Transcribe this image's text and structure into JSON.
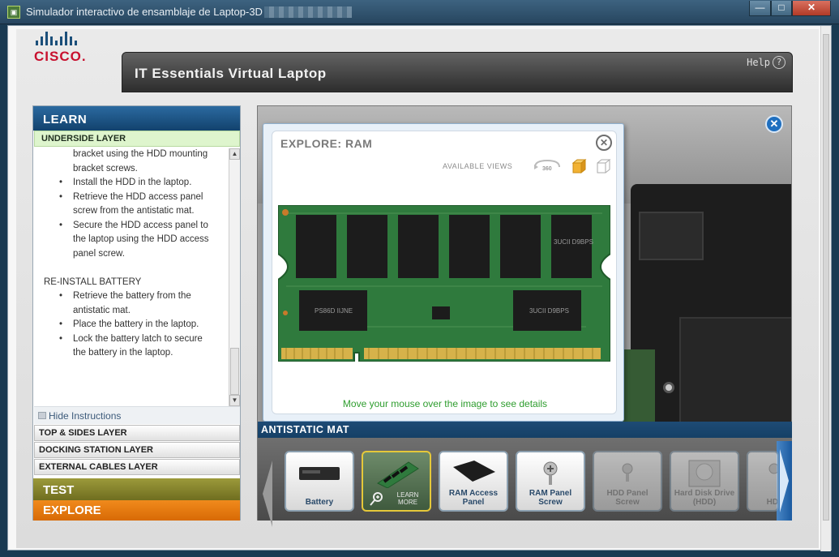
{
  "window": {
    "title": "Simulador interactivo de ensamblaje de Laptop-3D",
    "min": "—",
    "max": "□",
    "close": "✕"
  },
  "logo": {
    "text": "CISCO."
  },
  "header": {
    "title": "IT Essentials Virtual Laptop",
    "help": "Help",
    "help_icon": "?"
  },
  "sidebar": {
    "learn": "LEARN",
    "underside": "UNDERSIDE LAYER",
    "instructions": [
      {
        "type": "cont",
        "text": "bracket using the HDD mounting"
      },
      {
        "type": "cont",
        "text": "bracket screws."
      },
      {
        "type": "bullet",
        "text": "Install the HDD in the  laptop."
      },
      {
        "type": "bullet",
        "text": "Retrieve the HDD  access panel"
      },
      {
        "type": "cont",
        "text": "screw from the antistatic mat."
      },
      {
        "type": "bullet",
        "text": "Secure the HDD access  panel to"
      },
      {
        "type": "cont",
        "text": "the laptop using the HDD access"
      },
      {
        "type": "cont",
        "text": "panel screw."
      },
      {
        "type": "section",
        "text": "RE-INSTALL BATTERY"
      },
      {
        "type": "bullet",
        "text": "Retrieve the battery  from the"
      },
      {
        "type": "cont",
        "text": "antistatic mat."
      },
      {
        "type": "bullet",
        "text": "Place the battery in the  laptop."
      },
      {
        "type": "bullet",
        "text": "Lock the battery latch  to secure"
      },
      {
        "type": "cont",
        "text": "the battery in the laptop."
      }
    ],
    "hide": "Hide Instructions",
    "layers": [
      "TOP & SIDES LAYER",
      "DOCKING STATION LAYER",
      "EXTERNAL CABLES LAYER"
    ],
    "test": "TEST",
    "explore": "EXPLORE"
  },
  "popup": {
    "title": "EXPLORE: RAM",
    "close": "✕",
    "views_label": "AVAILABLE VIEWS",
    "view_360": "360",
    "hint": "Move your mouse over the image to see details",
    "chip_labels": [
      "3UCII D9BPS",
      "PS86D IIJNE",
      "3UCII D9BPS"
    ]
  },
  "main": {
    "close": "✕"
  },
  "strip": {
    "label": "ANTISTATIC MAT",
    "items": [
      {
        "label": "Battery",
        "state": "normal"
      },
      {
        "label": "",
        "state": "selected",
        "extra": "LEARN MORE"
      },
      {
        "label": "RAM Access Panel",
        "state": "normal"
      },
      {
        "label": "RAM Panel Screw",
        "state": "normal"
      },
      {
        "label": "HDD Panel Screw",
        "state": "dim"
      },
      {
        "label": "Hard Disk Drive (HDD)",
        "state": "dim"
      },
      {
        "label": "HDD Sc",
        "state": "dim"
      }
    ]
  },
  "colors": {
    "learn": "#12426d",
    "test": "#6f6d1f",
    "explore": "#d86a05",
    "hint": "#2e9d2e",
    "accent": "#1a5aa0"
  }
}
